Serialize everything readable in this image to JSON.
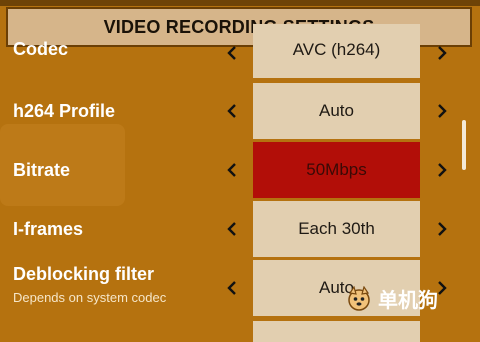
{
  "dialog": {
    "title": "VIDEO RECORDING SETTINGS"
  },
  "rows": [
    {
      "label": "Codec",
      "value": "AVC (h264)"
    },
    {
      "label": "h264 Profile",
      "value": "Auto"
    },
    {
      "label": "Bitrate",
      "value": "50Mbps"
    },
    {
      "label": "I-frames",
      "value": "Each 30th"
    },
    {
      "label": "Deblocking filter",
      "sublabel": "Depends on system codec",
      "value": "Auto"
    }
  ],
  "watermark": {
    "text": "单机狗"
  },
  "colors": {
    "background": "#b5720f",
    "value_box": "#e2cfb0",
    "selected_value_box": "#b20e08",
    "title_bar": "#d6b58a"
  },
  "icons": {
    "left_arrow": "chevron-left-icon",
    "right_arrow": "chevron-right-icon",
    "watermark_logo": "dog-logo-icon"
  }
}
